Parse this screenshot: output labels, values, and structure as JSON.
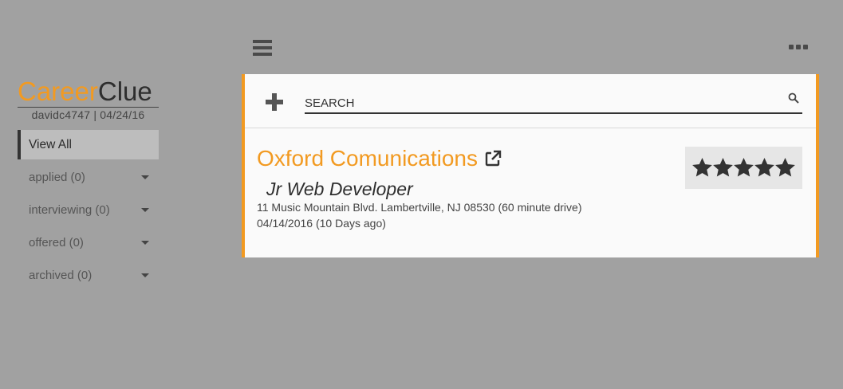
{
  "brand": {
    "part1": "Career",
    "part2": "Clue"
  },
  "user": {
    "line": "davidc4747 | 04/24/16"
  },
  "nav": {
    "items": [
      {
        "label": "View All"
      },
      {
        "label": "applied (0)"
      },
      {
        "label": "interviewing (0)"
      },
      {
        "label": "offered (0)"
      },
      {
        "label": "archived (0)"
      }
    ]
  },
  "search": {
    "placeholder": "SEARCH",
    "value": ""
  },
  "job": {
    "company": "Oxford Comunications",
    "title": "Jr Web Developer",
    "address": "11 Music Mountain Blvd. Lambertville, NJ 08530 (60 minute drive)",
    "date": "04/14/2016 (10 Days ago)",
    "rating": 5,
    "rating_max": 5
  },
  "colors": {
    "accent": "#f29a21",
    "background": "#a1a1a1",
    "card": "#fafafa"
  },
  "icons": [
    "menu-icon",
    "more-icon",
    "plus-icon",
    "search-icon",
    "external-link-icon",
    "star-icon"
  ]
}
